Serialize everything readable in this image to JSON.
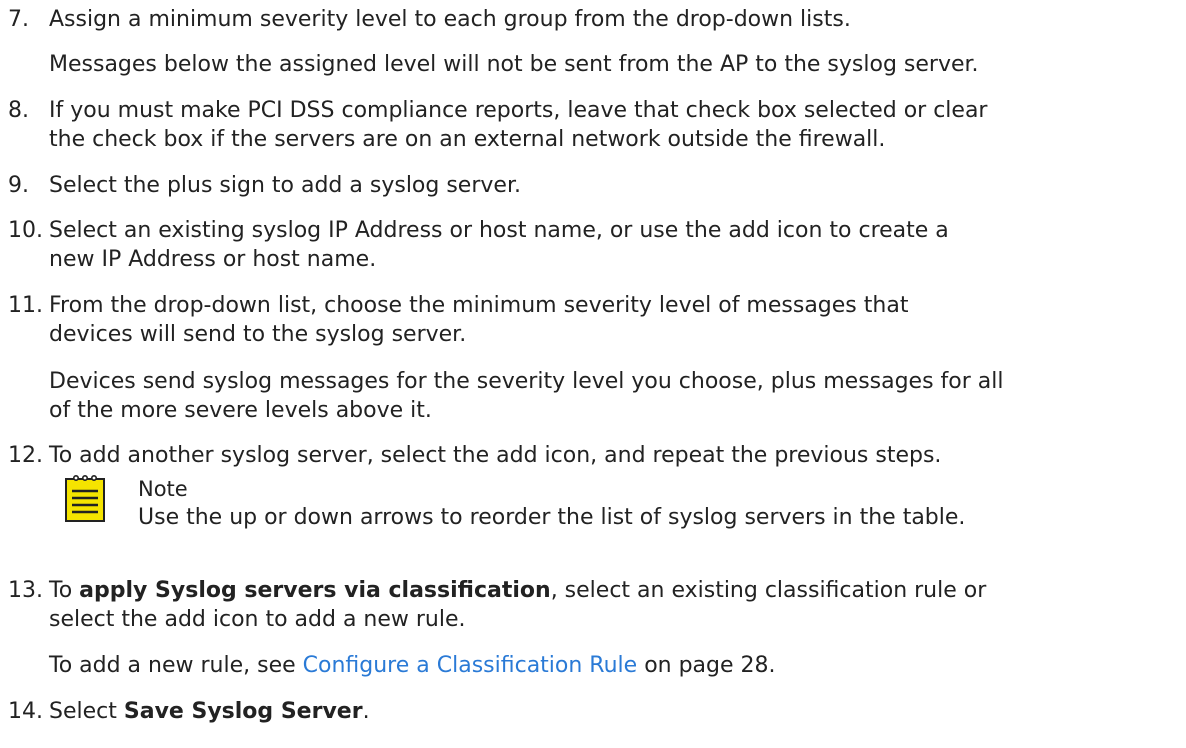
{
  "steps": [
    {
      "num": "7.",
      "lines": [
        "Assign a minimum severity level to each group from the drop-down lists."
      ],
      "para": [
        "Messages below the assigned level will not be sent from the AP to the syslog server."
      ]
    },
    {
      "num": "8.",
      "lines": [
        "If you must make PCI DSS compliance reports, leave that check box selected or clear",
        "the check box if the servers are on an external network outside the firewall."
      ]
    },
    {
      "num": "9.",
      "lines": [
        "Select the plus sign to add a syslog server."
      ]
    },
    {
      "num": "10.",
      "lines": [
        "Select an existing syslog IP Address or host name, or use the add icon to create a",
        "new IP Address or host name."
      ]
    },
    {
      "num": "11.",
      "lines": [
        "From the drop-down list, choose the minimum severity level of messages that",
        "devices will send to the syslog server."
      ],
      "para": [
        "Devices send syslog messages for the severity level you choose, plus messages for all",
        "of the more severe levels above it."
      ]
    },
    {
      "num": "12.",
      "lines": [
        "To add another syslog server, select the add icon, and repeat the previous steps."
      ]
    }
  ],
  "note": {
    "icon": "note-icon",
    "title": "Note",
    "text": "Use the up or down arrows to reorder the list of syslog servers in the table."
  },
  "step13": {
    "num": "13.",
    "pre": "To ",
    "bold": "apply Syslog servers via classification",
    "post": ", select an existing classification rule or",
    "line2": "select the add icon to add a new rule.",
    "para_pre": "To add a new rule, see ",
    "link": "Configure a Classification Rule",
    "para_post": " on page 28."
  },
  "step14": {
    "num": "14.",
    "pre": "Select ",
    "bold": "Save Syslog Server",
    "post": "."
  },
  "colors": {
    "link": "#2a7ad6",
    "note_icon": "#f5e400",
    "text": "#222222"
  }
}
